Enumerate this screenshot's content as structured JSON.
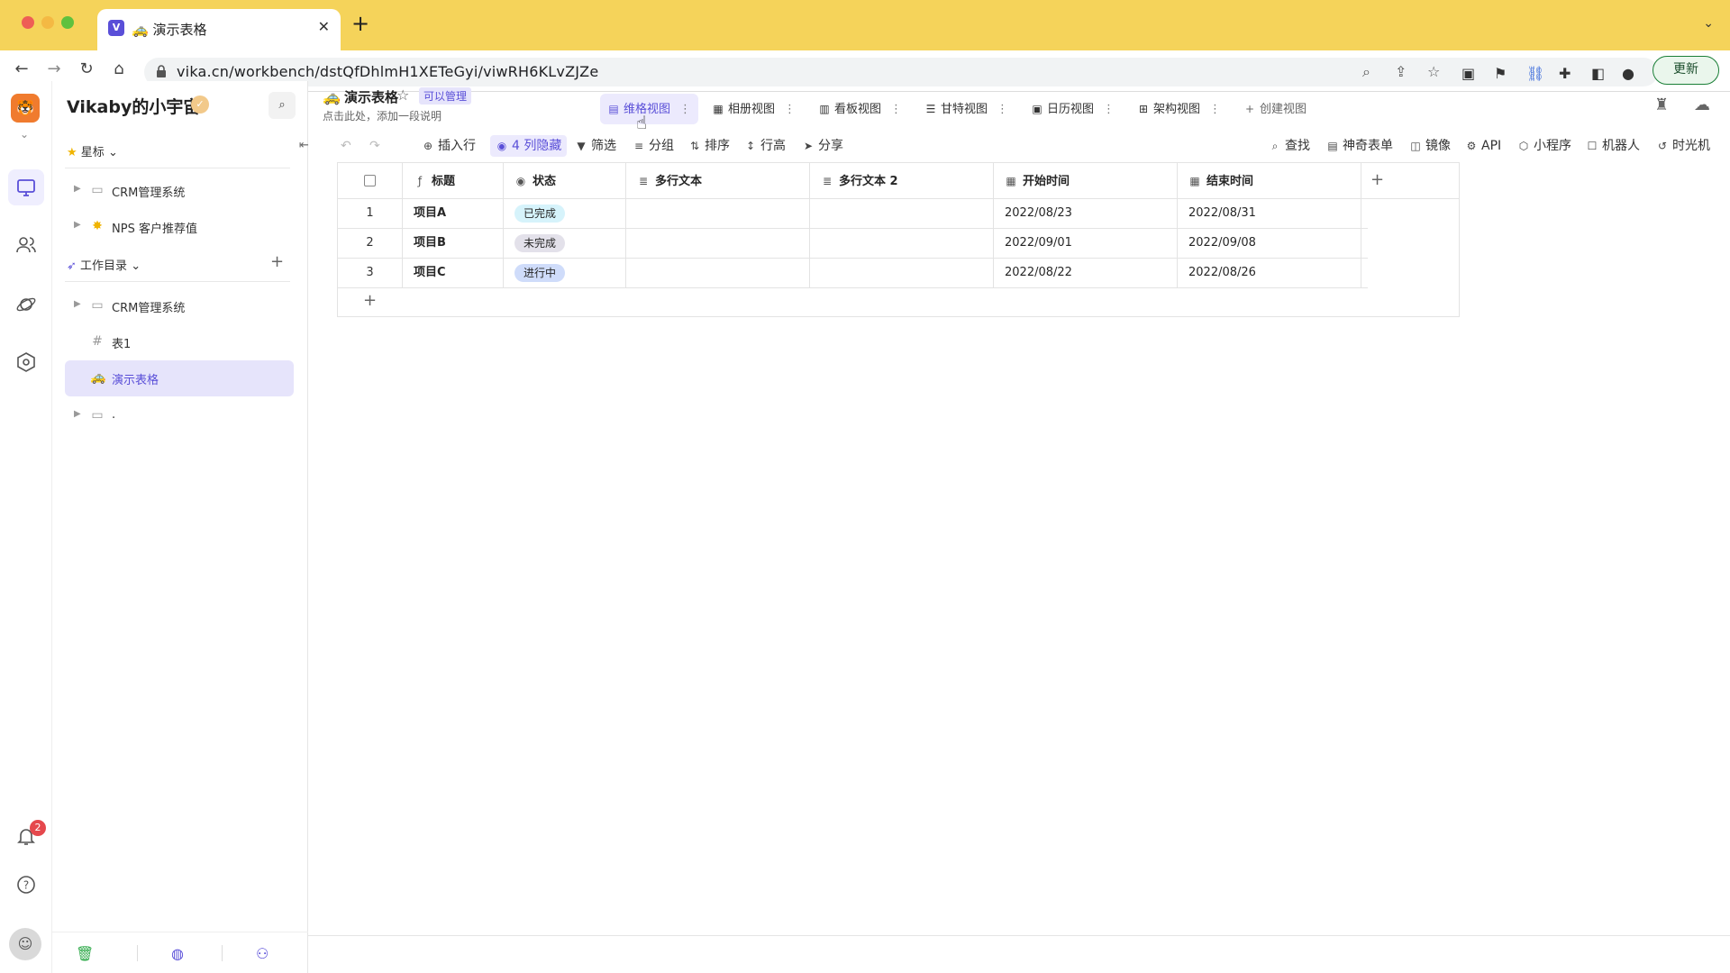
{
  "browser": {
    "tab_title": "🚕 演示表格",
    "tab_favicon": "V",
    "url": "vika.cn/workbench/dstQfDhlmH1XETeGyi/viwRH6KLvZJZe",
    "update_label": "更新"
  },
  "rail": {
    "notification_count": "2"
  },
  "sidebar": {
    "space_name": "Vikaby的小宇宙",
    "favorites_label": "星标",
    "favorites": [
      {
        "label": "CRM管理系统",
        "icon": "folder-icon"
      },
      {
        "label": "NPS 客户推荐值",
        "icon": "sparkle-icon"
      }
    ],
    "workdir_label": "工作目录",
    "workdir": [
      {
        "label": "CRM管理系统",
        "icon": "folder-icon"
      },
      {
        "label": "表1",
        "icon": "grid-icon"
      },
      {
        "label": "演示表格",
        "icon": "taxi-icon"
      },
      {
        "label": ".",
        "icon": "folder-icon"
      }
    ]
  },
  "header": {
    "doc_title": "演示表格",
    "doc_icon": "taxi-icon",
    "permission": "可以管理",
    "description": "点击此处，添加一段说明",
    "views": [
      {
        "label": "维格视图",
        "icon": "grid-view-icon",
        "active": true
      },
      {
        "label": "相册视图",
        "icon": "gallery-view-icon"
      },
      {
        "label": "看板视图",
        "icon": "kanban-view-icon"
      },
      {
        "label": "甘特视图",
        "icon": "gantt-view-icon"
      },
      {
        "label": "日历视图",
        "icon": "calendar-view-icon"
      },
      {
        "label": "架构视图",
        "icon": "architecture-view-icon"
      }
    ],
    "create_view": "创建视图"
  },
  "actions": {
    "insert_row": "插入行",
    "hidden_cols": "4 列隐藏",
    "filter": "筛选",
    "group": "分组",
    "sort": "排序",
    "row_height": "行高",
    "share": "分享",
    "find": "查找",
    "form": "神奇表单",
    "mirror": "镜像",
    "api": "API",
    "widget": "小程序",
    "robot": "机器人",
    "time_machine": "时光机"
  },
  "grid": {
    "columns": [
      {
        "label": "标题",
        "icon": "formula-icon"
      },
      {
        "label": "状态",
        "icon": "single-select-icon"
      },
      {
        "label": "多行文本",
        "icon": "multiline-text-icon"
      },
      {
        "label": "多行文本 2",
        "icon": "multiline-text-icon"
      },
      {
        "label": "开始时间",
        "icon": "date-icon"
      },
      {
        "label": "结束时间",
        "icon": "date-icon"
      }
    ],
    "rows": [
      {
        "num": "1",
        "title": "项目A",
        "status": "已完成",
        "status_color": "#d6f3fb",
        "text1": "",
        "text2": "",
        "start": "2022/08/23",
        "end": "2022/08/31"
      },
      {
        "num": "2",
        "title": "项目B",
        "status": "未完成",
        "status_color": "#e3e1ea",
        "text1": "",
        "text2": "",
        "start": "2022/09/01",
        "end": "2022/09/08"
      },
      {
        "num": "3",
        "title": "项目C",
        "status": "进行中",
        "status_color": "#cfdcfa",
        "text1": "",
        "text2": "",
        "start": "2022/08/22",
        "end": "2022/08/26"
      }
    ]
  },
  "colors": {
    "accent": "#5a4fd8",
    "browser_bar": "#f5d35a"
  }
}
